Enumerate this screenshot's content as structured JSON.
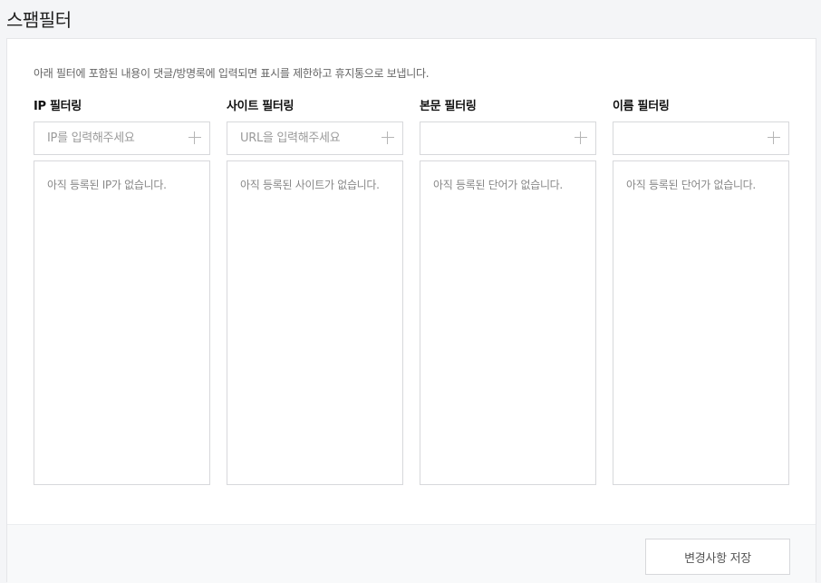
{
  "page": {
    "title": "스팸필터"
  },
  "description": "아래 필터에 포함된 내용이 댓글/방명록에 입력되면 표시를 제한하고 휴지통으로 보냅니다.",
  "filters": [
    {
      "title": "IP 필터링",
      "placeholder": "IP를 입력해주세요",
      "empty_message": "아직 등록된 IP가 없습니다."
    },
    {
      "title": "사이트 필터링",
      "placeholder": "URL을 입력해주세요",
      "empty_message": "아직 등록된 사이트가 없습니다."
    },
    {
      "title": "본문 필터링",
      "placeholder": "",
      "empty_message": "아직 등록된 단어가 없습니다."
    },
    {
      "title": "이름 필터링",
      "placeholder": "",
      "empty_message": "아직 등록된 단어가 없습니다."
    }
  ],
  "footer": {
    "save_label": "변경사항 저장"
  },
  "icons": {
    "add": "plus-icon"
  },
  "colors": {
    "background": "#f4f5f7",
    "panel": "#ffffff",
    "border": "#d7d8db",
    "placeholder_text": "#9a9a9a"
  }
}
